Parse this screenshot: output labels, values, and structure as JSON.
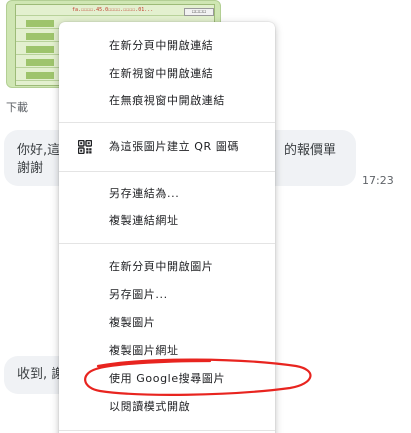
{
  "thumbnail": {
    "link_text": "fa.☐☐☐☐.45.0☐☐☐☐.☐☐☐☐.01...",
    "button_text": "☐☐☐☐"
  },
  "chat": {
    "download_label": "下載",
    "message_1_line_1": "你好,這",
    "message_1_tail": "的報價單",
    "message_1_line_2": "謝謝",
    "message_1_time": "17:23",
    "message_2": "收到, 謝"
  },
  "menu": {
    "open_link_new_tab": "在新分頁中開啟連結",
    "open_link_new_window": "在新視窗中開啟連結",
    "open_link_incognito": "在無痕視窗中開啟連結",
    "create_qr": "為這張圖片建立 QR 圖碼",
    "save_link_as": "另存連結為...",
    "copy_link_address": "複製連結網址",
    "open_image_new_tab": "在新分頁中開啟圖片",
    "save_image_as": "另存圖片...",
    "copy_image": "複製圖片",
    "copy_image_address": "複製圖片網址",
    "search_google": "使用 Google搜尋圖片",
    "open_reader_mode": "以閱讀模式開啟"
  },
  "icons": {
    "qr": "qr-code-icon"
  },
  "colors": {
    "annotation_circle": "#e8241f",
    "thumbnail_background": "#cfe6b3",
    "bubble_background": "#f0f2f5"
  }
}
